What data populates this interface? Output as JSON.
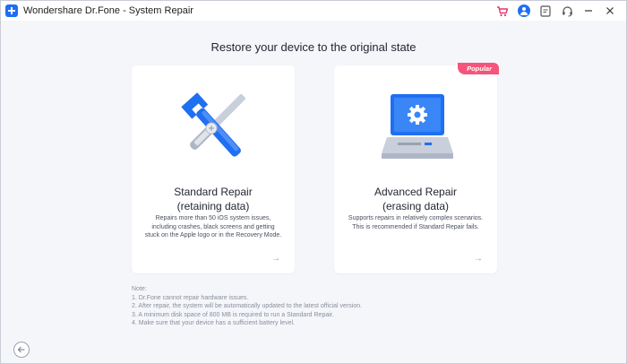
{
  "window": {
    "title": "Wondershare Dr.Fone - System Repair"
  },
  "titlebar_icons": [
    "cart-icon",
    "account-avatar-icon",
    "feedback-icon",
    "support-headset-icon",
    "minimize-icon",
    "close-icon"
  ],
  "colors": {
    "accent": "#1f6ff2",
    "badge": "#f6547a",
    "cart": "#e8336d",
    "background": "#f5f6fa"
  },
  "main": {
    "heading": "Restore your device to the original state",
    "cards": [
      {
        "title_line1": "Standard Repair",
        "title_line2": "(retaining data)",
        "description": "Repairs more than 50 iOS system issues, including crashes, black screens and getting stuck on the Apple logo or in the Recovery Mode.",
        "icon": "tools-icon",
        "arrow": "→"
      },
      {
        "badge": "Popular",
        "title_line1": "Advanced Repair",
        "title_line2": "(erasing data)",
        "description": "Supports repairs in relatively complex scenarios. This is recommended if Standard Repair fails.",
        "icon": "computer-gear-icon",
        "arrow": "→"
      }
    ],
    "notes": {
      "label": "Note:",
      "items": [
        "1. Dr.Fone cannot repair hardware issues.",
        "2. After repair, the system will be automatically updated to the latest official version.",
        "3. A minimum disk space of 800 MB is required to run a Standard Repair.",
        "4. Make sure that your device has a sufficient battery level."
      ]
    }
  }
}
